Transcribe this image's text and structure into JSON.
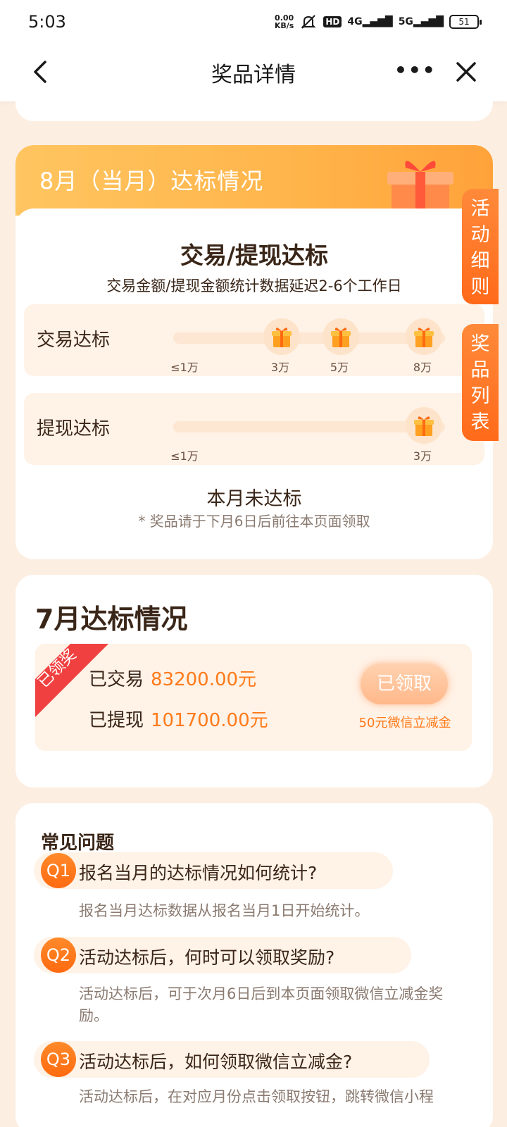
{
  "status_bar": {
    "time": "5:03",
    "net_speed_value": "0.00",
    "net_speed_unit": "KB/s",
    "hd_label": "HD",
    "signal1": "4G",
    "signal2": "5G",
    "battery": "51"
  },
  "nav": {
    "title": "奖品详情"
  },
  "august": {
    "header_title": "8月（当月）达标情况",
    "section_title": "交易/提现达标",
    "subtitle": "交易金额/提现金额统计数据延迟2-6个工作日",
    "trade_row": {
      "label": "交易达标",
      "ticks": [
        "≤1万",
        "3万",
        "5万",
        "8万"
      ]
    },
    "withdraw_row": {
      "label": "提现达标",
      "ticks": [
        "≤1万",
        "3万"
      ]
    },
    "status": "本月未达标",
    "note": "* 奖品请于下月6日后前往本页面领取"
  },
  "side_tabs": {
    "rules": "活动细则",
    "prizes": "奖品列表"
  },
  "july": {
    "title": "7月达标情况",
    "ribbon": "已领奖",
    "trade_label": "已交易",
    "trade_amount": "83200.00元",
    "withdraw_label": "已提现",
    "withdraw_amount": "101700.00元",
    "button_label": "已领取",
    "reward": "50元微信立减金"
  },
  "faq": {
    "title": "常见问题",
    "items": [
      {
        "badge": "Q1",
        "question": "报名当月的达标情况如何统计?",
        "answer": "报名当月达标数据从报名当月1日开始统计。"
      },
      {
        "badge": "Q2",
        "question": "活动达标后，何时可以领取奖励?",
        "answer": "活动达标后，可于次月6日后到本页面领取微信立减金奖励。"
      },
      {
        "badge": "Q3",
        "question": "活动达标后，如何领取微信立减金?",
        "answer": "活动达标后，在对应月份点击领取按钮，跳转微信小程"
      }
    ]
  },
  "colors": {
    "accent": "#ff7a1a",
    "header_gradient_start": "#ffc560",
    "header_gradient_end": "#ffa23a",
    "page_bg": "#fdeee2"
  }
}
